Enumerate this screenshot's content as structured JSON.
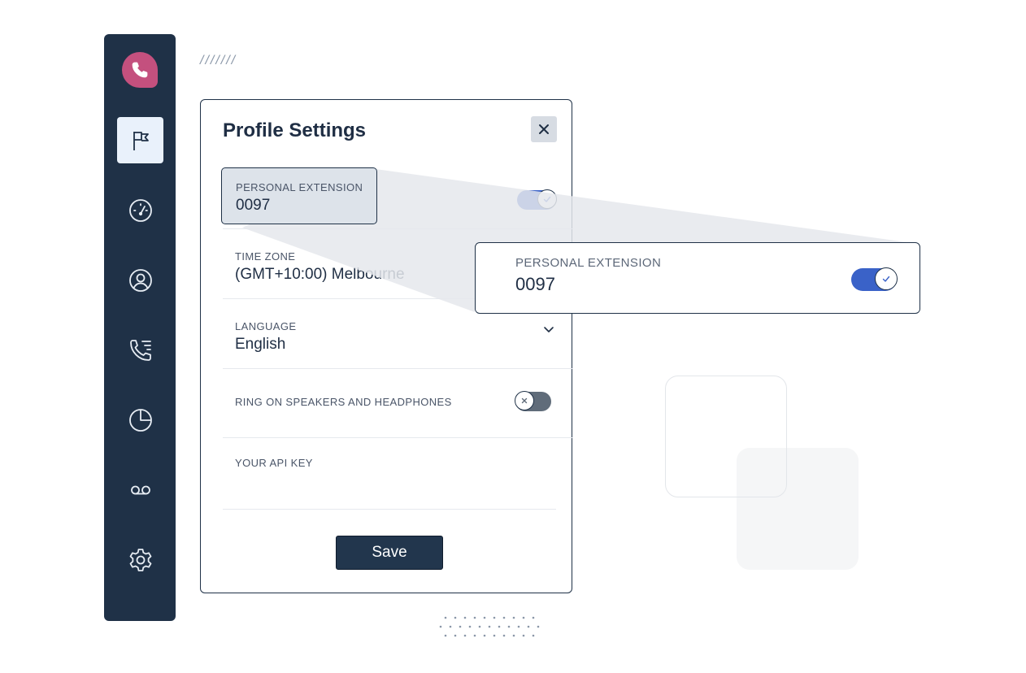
{
  "header": {
    "decoration": "///////"
  },
  "sidebar": {
    "items": [
      {
        "name": "phone-logo-icon",
        "active": false
      },
      {
        "name": "flag-icon",
        "active": true
      },
      {
        "name": "gauge-icon",
        "active": false
      },
      {
        "name": "user-circle-icon",
        "active": false
      },
      {
        "name": "call-list-icon",
        "active": false
      },
      {
        "name": "pie-chart-icon",
        "active": false
      },
      {
        "name": "voicemail-icon",
        "active": false
      },
      {
        "name": "settings-gear-icon",
        "active": false
      }
    ]
  },
  "dialog": {
    "title": "Profile Settings",
    "close_icon": "close-icon",
    "personal_extension": {
      "label": "PERSONAL EXTENSION",
      "value": "0097",
      "toggle_on": true
    },
    "time_zone": {
      "label": "TIME ZONE",
      "value": "(GMT+10:00) Melbourne"
    },
    "language": {
      "label": "LANGUAGE",
      "value": "English"
    },
    "ring_speakers": {
      "label": "RING ON SPEAKERS AND HEADPHONES",
      "toggle_on": false
    },
    "api_key": {
      "label": "YOUR API KEY",
      "value": ""
    },
    "save_label": "Save"
  },
  "callout": {
    "label": "PERSONAL EXTENSION",
    "value": "0097",
    "toggle_on": true
  },
  "colors": {
    "sidebar_bg": "#1f3147",
    "logo": "#c4507e",
    "toggle_on": "#3a62c8",
    "toggle_off": "#606c7a",
    "save_bg": "#22364d"
  }
}
